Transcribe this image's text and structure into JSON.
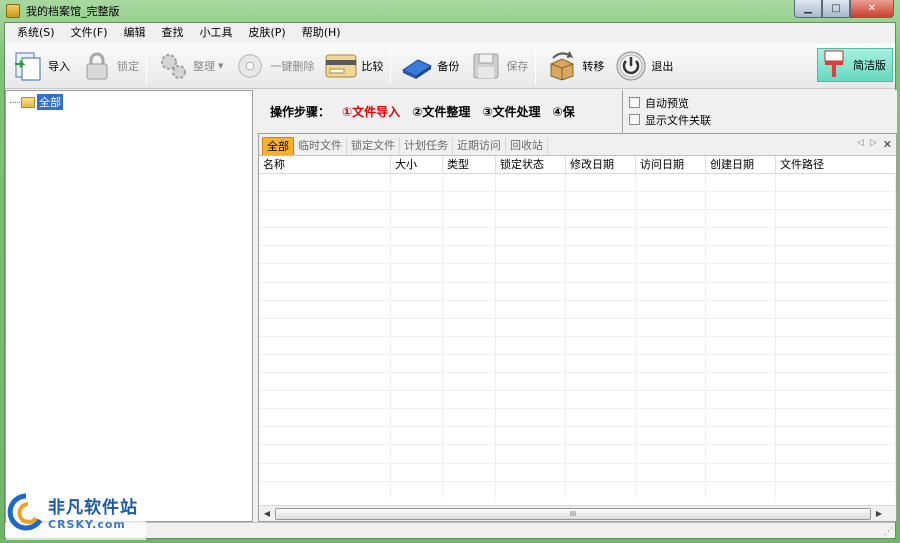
{
  "window": {
    "title": "我的档案馆_完整版"
  },
  "menu": [
    "系统(S)",
    "文件(F)",
    "编辑",
    "查找",
    "小工具",
    "皮肤(P)",
    "帮助(H)"
  ],
  "toolbar": {
    "import": "导入",
    "lock": "锁定",
    "organize": "整理",
    "one_click_delete": "一键删除",
    "compare": "比较",
    "backup": "备份",
    "save": "保存",
    "transfer": "转移",
    "exit": "退出",
    "simple_edition": "简洁版"
  },
  "tree": {
    "root": "全部"
  },
  "steps": {
    "label": "操作步骤：",
    "step1": "①文件导入",
    "step2": "②文件整理",
    "step3": "③文件处理",
    "step4": "④保"
  },
  "options": {
    "auto_preview": "自动预览",
    "show_file_assoc": "显示文件关联"
  },
  "tabs": [
    "全部",
    "临时文件",
    "锁定文件",
    "计划任务",
    "近期访问",
    "回收站"
  ],
  "columns": [
    "名称",
    "大小",
    "类型",
    "锁定状态",
    "修改日期",
    "访问日期",
    "创建日期",
    "文件路径"
  ],
  "scroll_thumb": "III",
  "watermark": {
    "cn": "非凡软件站",
    "en": "CRSKY.com"
  },
  "colors": {
    "accent_tab": "#f8b030",
    "step_active": "#e00000",
    "selection": "#3070c8"
  }
}
